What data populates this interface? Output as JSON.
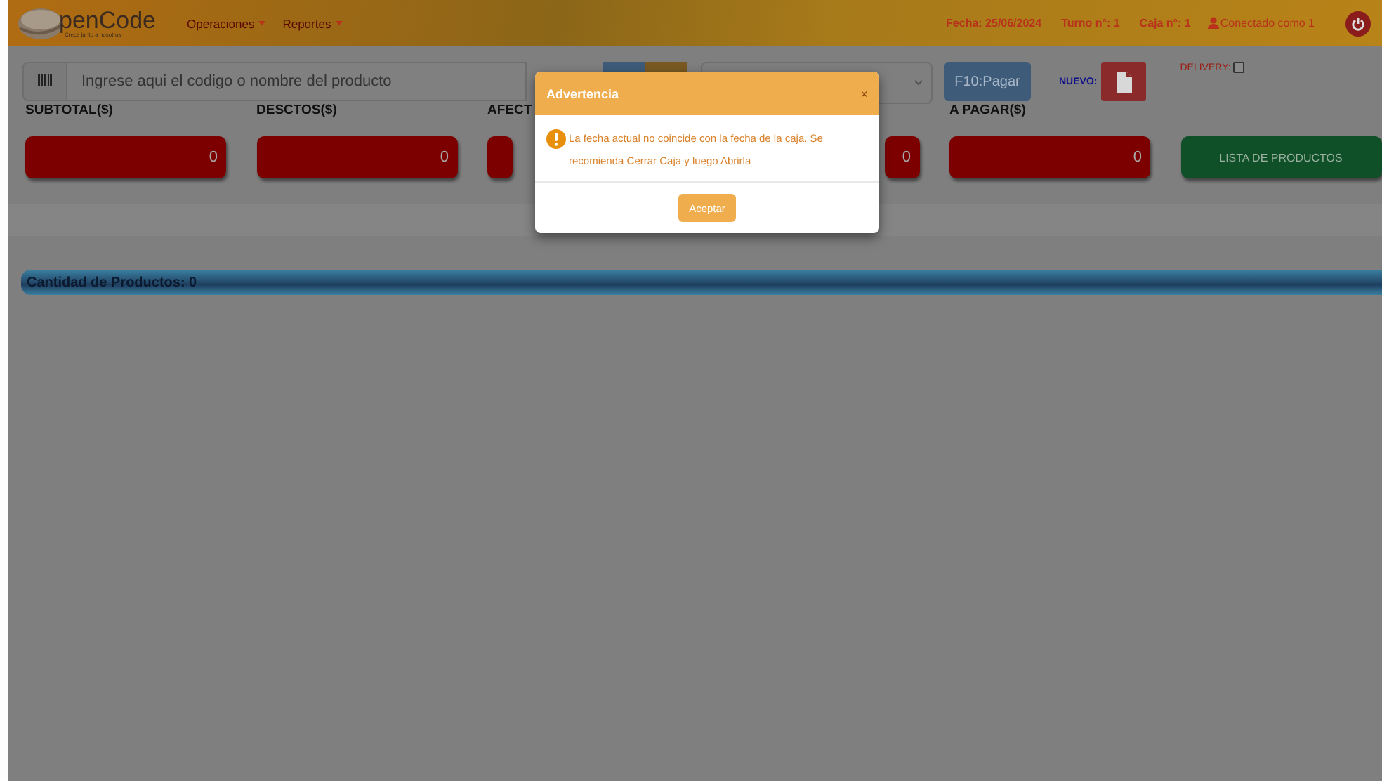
{
  "navbar": {
    "brand": "penCode",
    "tagline": "Crece junto a nosotros",
    "menus": [
      {
        "label": "Operaciones"
      },
      {
        "label": "Reportes"
      }
    ],
    "info": [
      "Fecha: 25/06/2024",
      "Turno n°: 1",
      "Caja n°: 1"
    ],
    "user": "Conectado como 1"
  },
  "toolbar": {
    "search": {
      "placeholder": "Ingrese aqui el codigo o nombre del producto"
    },
    "pay_button": "F10:Pagar",
    "new_label": "NUEVO:",
    "delivery": {
      "label": "DELIVERY:",
      "checked": false
    }
  },
  "totals": [
    {
      "label": "SUBTOTAL($)",
      "value": "0"
    },
    {
      "label": "DESCTOS($)",
      "value": "0"
    },
    {
      "label": "AFECT"
    },
    {
      "value": "0"
    },
    {
      "label": "A PAGAR($)",
      "value": "0"
    }
  ],
  "list_button": "LISTA DE PRODUCTOS",
  "product_count": "Cantidad de Productos: 0",
  "modal": {
    "title": "Advertencia",
    "close": "×",
    "message": "La fecha actual no coincide con la fecha de la caja. Se recomienda Cerrar Caja y luego Abrirla",
    "button": "Aceptar"
  }
}
